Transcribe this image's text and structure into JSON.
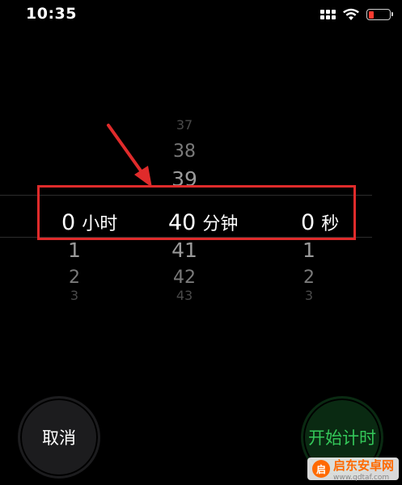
{
  "status_bar": {
    "time": "10:35",
    "battery_color": "#ff3b30",
    "icons": [
      "cellular-grid-icon",
      "wifi-icon",
      "battery-low-icon"
    ]
  },
  "picker": {
    "hours": {
      "above": [],
      "selected": "0",
      "unit": "小时",
      "below": [
        "1",
        "2",
        "3"
      ]
    },
    "minutes": {
      "above": [
        "37",
        "38",
        "39"
      ],
      "selected": "40",
      "unit": "分钟",
      "below": [
        "41",
        "42",
        "43"
      ]
    },
    "seconds": {
      "above": [],
      "selected": "0",
      "unit": "秒",
      "below": [
        "1",
        "2",
        "3"
      ]
    }
  },
  "buttons": {
    "cancel": "取消",
    "start": "开始计时"
  },
  "annotation": {
    "color": "#e02b2b"
  },
  "watermark": {
    "logo": "启",
    "text": "启东安卓网",
    "url": "www.qdtaf.com"
  }
}
